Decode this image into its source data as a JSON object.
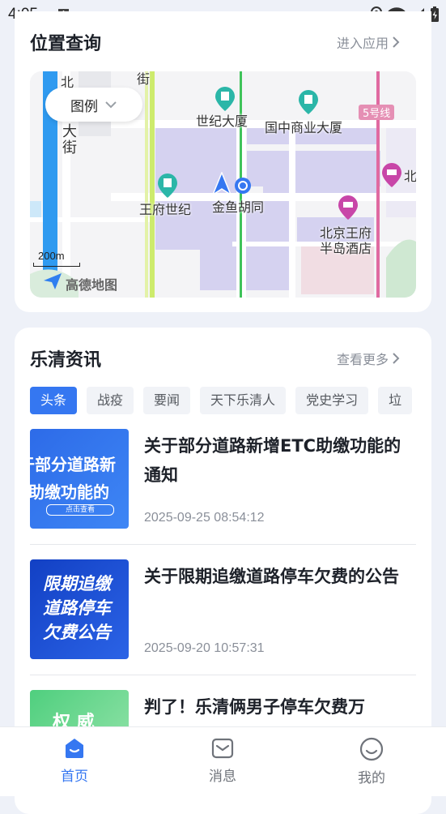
{
  "status_bar": {
    "time": "4:05",
    "notif_letter": "A"
  },
  "location": {
    "title": "位置查询",
    "enter_app": "进入应用",
    "legend": "图例",
    "scale": "200m",
    "map_brand": "高德地图",
    "labels": {
      "shijidasha": "世纪大厦",
      "guozhong": "国中商业大厦",
      "line5": "5号线",
      "wangfushiji": "王府世纪",
      "jinyuhutong": "金鱼胡同",
      "peninsula_l1": "北京王府",
      "peninsula_l2": "半岛酒店",
      "bei": "北",
      "da": "大",
      "jie": "街",
      "jie2": "街",
      "bei2": "北"
    }
  },
  "news": {
    "title": "乐清资讯",
    "more": "查看更多",
    "tabs": [
      "头条",
      "战疫",
      "要闻",
      "天下乐清人",
      "党史学习",
      "垃"
    ],
    "items": [
      {
        "title": "关于部分道路新增ETC助缴功能的通知",
        "date": "2025-09-25 08:54:12",
        "thumb_line1": "于部分道路新",
        "thumb_line2": "助缴功能的",
        "thumb_btn": "点击查看"
      },
      {
        "title": "关于限期追缴道路停车欠费的公告",
        "date": "2025-09-20 10:57:31",
        "thumb_line1": "限期追缴",
        "thumb_line2": "道路停车",
        "thumb_line3": "欠费公告"
      },
      {
        "title": "判了！乐清俩男子停车欠费万",
        "thumb_line1": "权 威"
      }
    ]
  },
  "bottom_nav": [
    {
      "label": "首页",
      "active": true
    },
    {
      "label": "消息",
      "active": false
    },
    {
      "label": "我的",
      "active": false
    }
  ],
  "colors": {
    "accent": "#3577f1",
    "map_blue_road": "#2f9af0",
    "map_green_line": "#3fc35a",
    "map_pink_line": "#e06aa1"
  }
}
